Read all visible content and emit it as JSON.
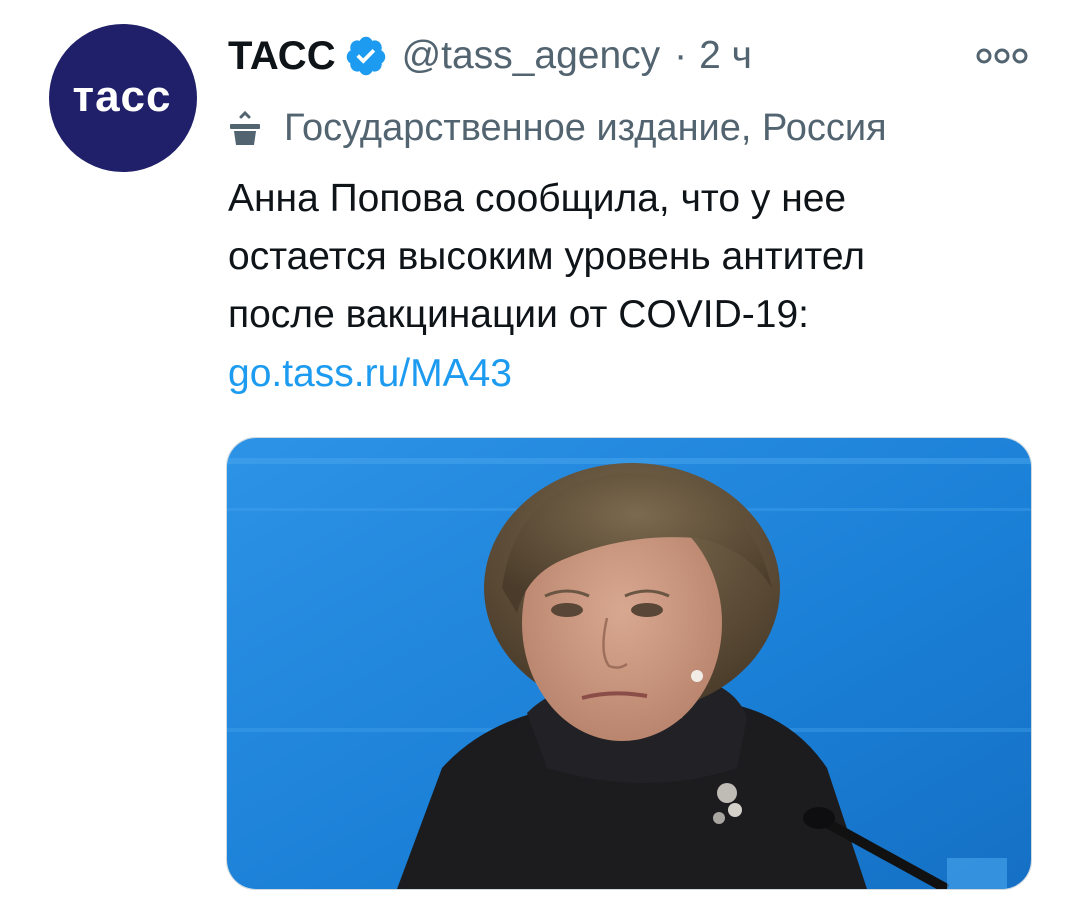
{
  "tweet": {
    "author": {
      "display_name": "ТАСС",
      "handle": "@tass_agency",
      "avatar_text": "тасс",
      "verified": true
    },
    "separator": "·",
    "time": "2 ч",
    "label": "Государственное издание, Россия",
    "text_lines": [
      "Анна Попова сообщила, что у нее",
      "остается высоким уровень антител",
      "после вакцинации от COVID-19:"
    ],
    "link": "go.tass.ru/MA43",
    "media": {
      "icon": "photo",
      "description_icon": "woman-portrait"
    }
  },
  "colors": {
    "avatar_bg": "#20206a",
    "verified_blue": "#1d9bf0",
    "link_blue": "#1d9bf0",
    "secondary_text": "#536471",
    "photo_bg": "#1f86d9"
  }
}
